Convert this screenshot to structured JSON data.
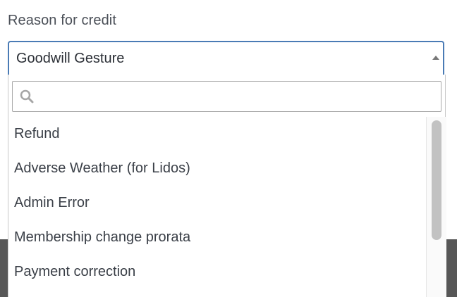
{
  "field": {
    "label": "Reason for credit",
    "selected_value": "Goodwill Gesture"
  },
  "dropdown": {
    "search_placeholder": "",
    "search_value": "",
    "options": [
      "Refund",
      "Adverse Weather (for Lidos)",
      "Admin Error",
      "Membership change prorata",
      "Payment correction"
    ]
  },
  "icons": {
    "search": "search-icon",
    "caret": "caret-up-icon"
  },
  "colors": {
    "focus_border": "#4a7bb5",
    "text": "#3a3f47",
    "scrollbar_thumb": "#c2c2c2"
  }
}
